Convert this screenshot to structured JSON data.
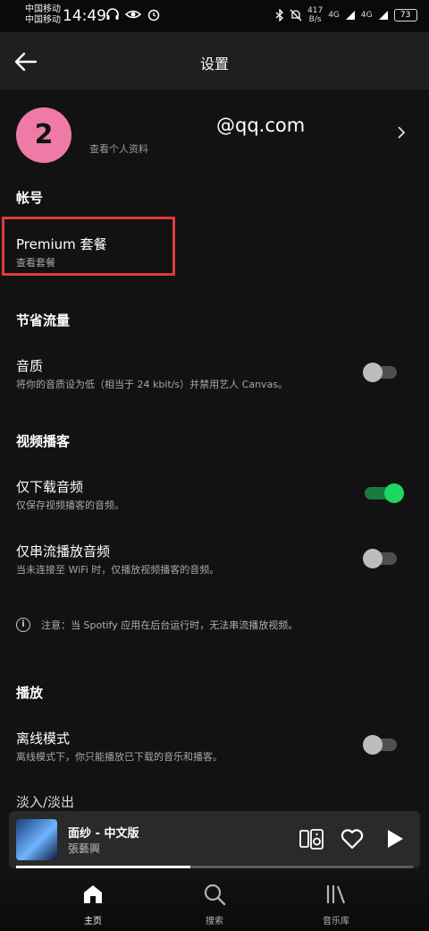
{
  "status_bar": {
    "carrier_1": "中国移动",
    "carrier_2": "中国移动",
    "time": "14:49",
    "net_speed_value": "417",
    "net_speed_unit": "B/s",
    "signal_1": "4G",
    "signal_2": "4G",
    "battery": "73"
  },
  "header": {
    "title": "设置"
  },
  "profile": {
    "avatar_letter": "2",
    "email": "@qq.com",
    "subtitle": "查看个人资料"
  },
  "account": {
    "section_title": "帐号",
    "plan_title": "Premium 套餐",
    "plan_sub": "查看套餐"
  },
  "data_saver": {
    "section_title": "节省流量",
    "audio_quality_title": "音质",
    "audio_quality_sub": "将你的音质设为低（相当于 24 kbit/s）并禁用艺人 Canvas。",
    "audio_quality_on": false
  },
  "podcasts": {
    "section_title": "视频播客",
    "download_audio_title": "仅下载音频",
    "download_audio_sub": "仅保存视频播客的音频。",
    "download_audio_on": true,
    "stream_audio_title": "仅串流播放音频",
    "stream_audio_sub": "当未连接至 WiFi 时，仅播放视频播客的音频。",
    "stream_audio_on": false,
    "note": "注意：当 Spotify 应用在后台运行时，无法串流播放视频。"
  },
  "playback": {
    "section_title": "播放",
    "offline_title": "离线模式",
    "offline_sub": "离线模式下，你只能播放已下载的音乐和播客。",
    "offline_on": false,
    "crossfade_title": "淡入/淡出"
  },
  "now_playing": {
    "title": "面纱 - 中文版",
    "artist": "張藝興",
    "progress": 0.44
  },
  "bottom_nav": {
    "home": "主页",
    "search": "搜索",
    "library": "音乐库"
  },
  "colors": {
    "accent_green": "#1ed760",
    "avatar_pink": "#f07aa6",
    "highlight_red": "#e03a3a"
  },
  "icons": {
    "back": "arrow-left-icon",
    "chevron": "chevron-right-icon",
    "info": "info-icon",
    "devices": "connect-device-icon",
    "like": "heart-outline-icon",
    "play": "play-icon",
    "home": "home-icon",
    "search": "search-icon",
    "library": "library-icon"
  }
}
